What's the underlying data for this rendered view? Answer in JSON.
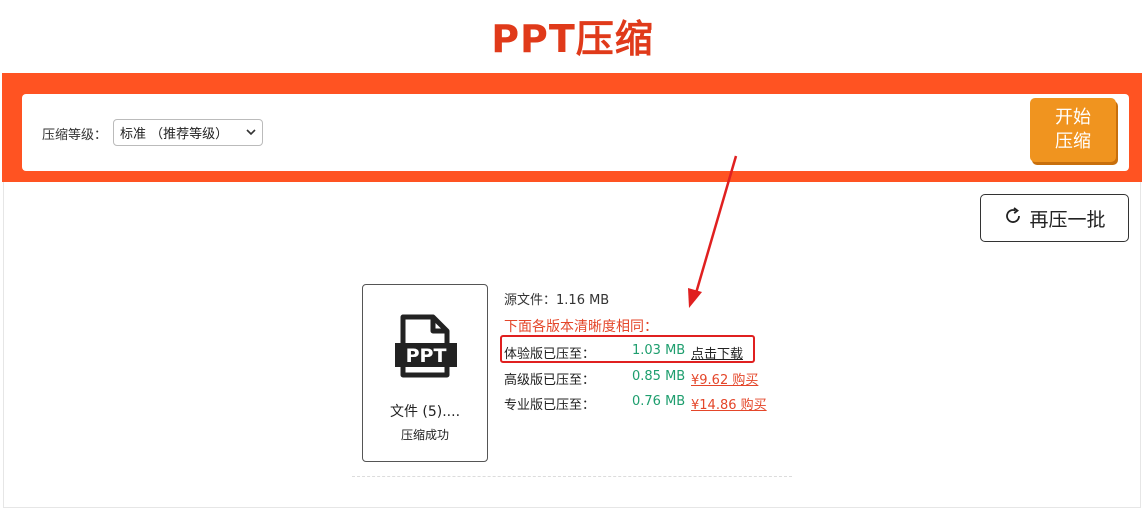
{
  "header": {
    "title": "PPT压缩"
  },
  "toolbar": {
    "level_label": "压缩等级：",
    "level_selected": "标准 （推荐等级）",
    "start_line1": "开始",
    "start_line2": "压缩"
  },
  "actions": {
    "redo_label": "再压一批"
  },
  "file": {
    "icon_text": "PPT",
    "name": "文件 (5)....",
    "status": "压缩成功"
  },
  "result": {
    "source_label": "源文件：",
    "source_size": "1.16 MB",
    "note": "下面各版本清晰度相同：",
    "rows": [
      {
        "label": "体验版已压至：",
        "size": "1.03 MB",
        "link": "点击下载"
      },
      {
        "label": "高级版已压至：",
        "size": "0.85 MB",
        "link": "¥9.62 购买"
      },
      {
        "label": "专业版已压至：",
        "size": "0.76 MB",
        "link": "¥14.86 购买"
      }
    ]
  },
  "colors": {
    "brand": "#ff5322",
    "button": "#f0941f",
    "title": "#e03a1a",
    "size_text": "#1e9e6e",
    "annotation": "#e02020"
  },
  "icons": [
    "ppt-file-icon",
    "refresh-icon",
    "chevron-down-icon"
  ]
}
